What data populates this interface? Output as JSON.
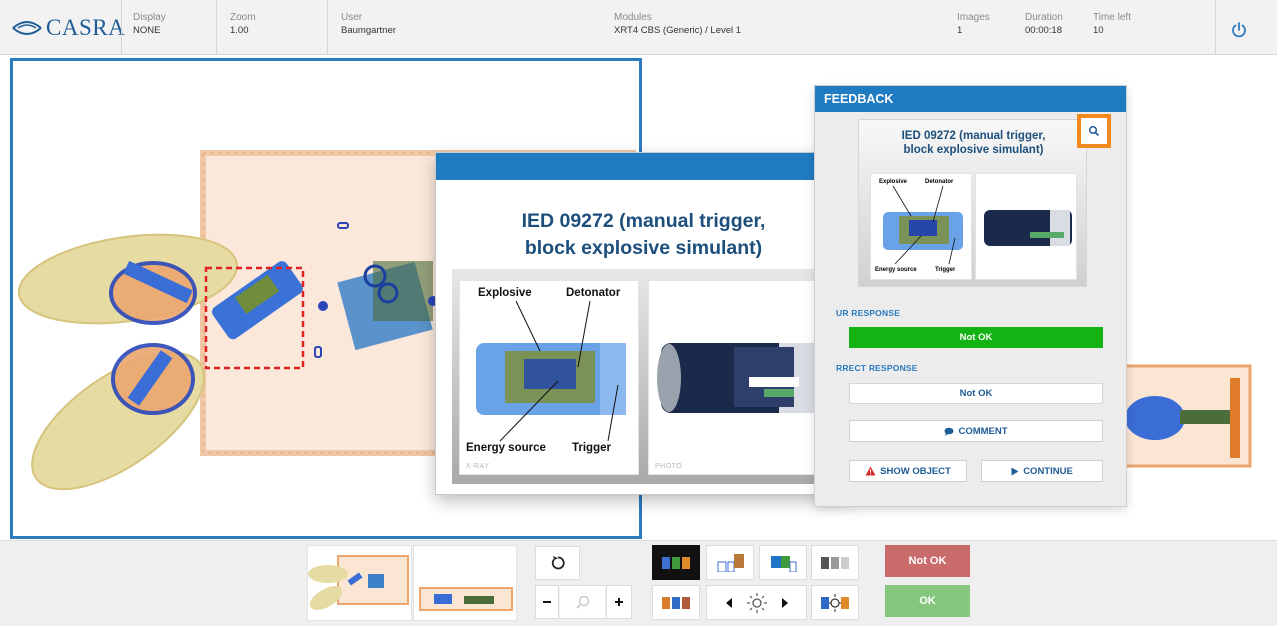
{
  "header": {
    "logo_text": "CASRA",
    "display": {
      "label": "Display",
      "value": "NONE"
    },
    "zoom": {
      "label": "Zoom",
      "value": "1.00"
    },
    "user": {
      "label": "User",
      "value": "Baumgartner"
    },
    "modules": {
      "label": "Modules",
      "value": "XRT4 CBS (Generic) / Level 1"
    },
    "images": {
      "label": "Images",
      "value": "1"
    },
    "duration": {
      "label": "Duration",
      "value": "00:00:18"
    },
    "time_left": {
      "label": "Time left",
      "value": "10"
    }
  },
  "popup": {
    "title_line1": "IED 09272 (manual trigger,",
    "title_line2": "block explosive simulant)",
    "xray_caption": "X-RAY",
    "photo_caption": "PHOTO",
    "labels": {
      "explosive": "Explosive",
      "detonator": "Detonator",
      "energy_source": "Energy source",
      "trigger": "Trigger"
    }
  },
  "feedback": {
    "heading": "FEEDBACK",
    "card_title_line1": "IED 09272 (manual trigger,",
    "card_title_line2": "block explosive simulant)",
    "your_response_label": "UR RESPONSE",
    "your_response_value": "Not OK",
    "correct_response_label": "RRECT RESPONSE",
    "correct_response_value": "Not OK",
    "comment_label": "COMMENT",
    "show_object_label": "SHOW OBJECT",
    "continue_label": "CONTINUE"
  },
  "toolbar": {
    "not_ok_label": "Not OK",
    "ok_label": "OK"
  },
  "colors": {
    "accent_blue": "#1f7bc2",
    "highlight_orange": "#f08a1c",
    "response_green": "#12b312",
    "not_ok_red": "#c96b6b",
    "ok_green": "#86c77e"
  }
}
